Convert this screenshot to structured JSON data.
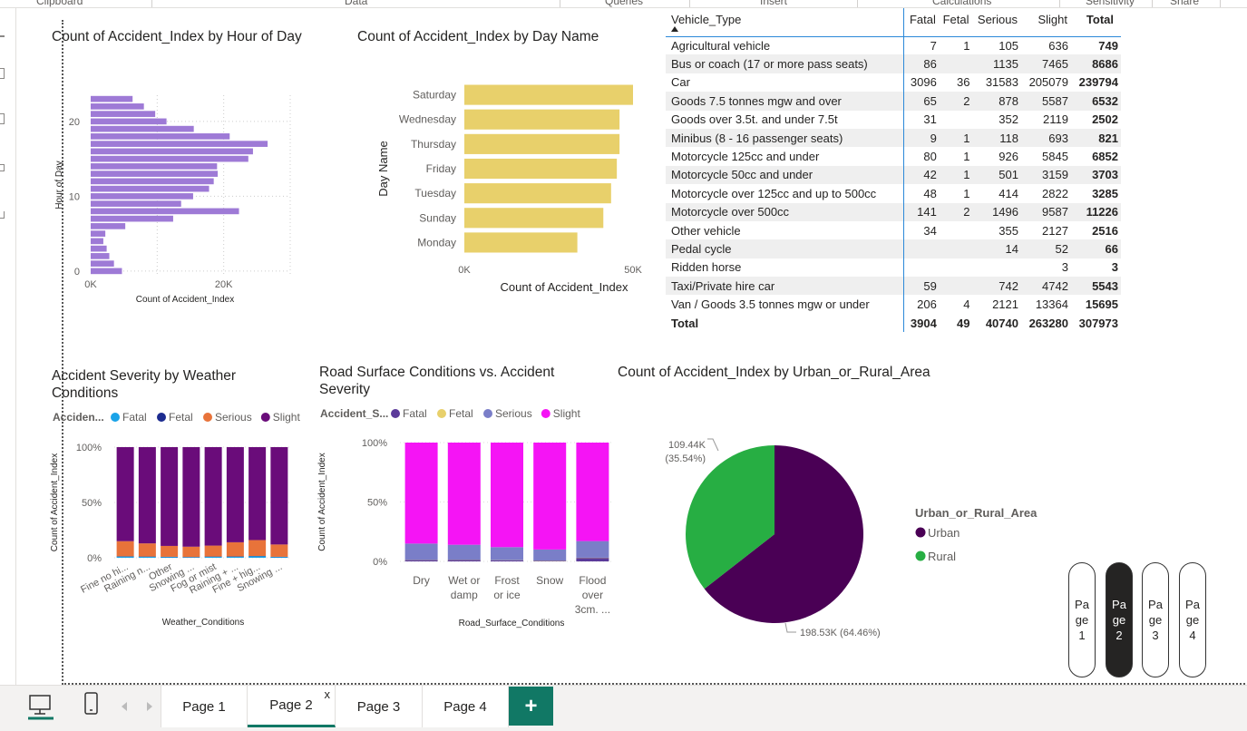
{
  "ribbon": {
    "groups": [
      "Clipboard",
      "Data",
      "Queries",
      "Insert",
      "Calculations",
      "Sensitivity",
      "Share"
    ]
  },
  "colors": {
    "hour_bar": "#9e7ad6",
    "day_bar": "#e8d06b",
    "fatal_weather": "#1aa3e8",
    "fetal_weather": "#1c2b8f",
    "serious_weather": "#e8733a",
    "slight_weather": "#6a0c7a",
    "fatal_road": "#5b3a9a",
    "fetal_road": "#e8d06b",
    "serious_road": "#7a7ec8",
    "slight_road": "#f514f5",
    "urban": "#4a0055",
    "rural": "#27ae43",
    "accent": "#117865"
  },
  "chart_data": [
    {
      "type": "bar",
      "orientation": "horizontal",
      "title": "Count of Accident_Index by Hour of Day",
      "xlabel": "Count of Accident_Index",
      "ylabel": "Hour of Day",
      "x_ticks": [
        "0K",
        "20K"
      ],
      "y_ticks": [
        "0",
        "10",
        "20"
      ],
      "xlim": [
        0,
        30000
      ],
      "categories": [
        0,
        1,
        2,
        3,
        4,
        5,
        6,
        7,
        8,
        9,
        10,
        11,
        12,
        13,
        14,
        15,
        16,
        17,
        18,
        19,
        20,
        21,
        22,
        23
      ],
      "values": [
        4700,
        3500,
        2800,
        2400,
        1900,
        2200,
        5200,
        12400,
        22300,
        13600,
        15400,
        17800,
        18500,
        19100,
        19000,
        23700,
        24400,
        26600,
        20900,
        15500,
        11400,
        9700,
        8000,
        6300
      ]
    },
    {
      "type": "bar",
      "orientation": "horizontal",
      "title": "Count of Accident_Index by Day Name",
      "xlabel": "Count of Accident_Index",
      "ylabel": "Day Name",
      "x_ticks": [
        "0K",
        "50K"
      ],
      "xlim": [
        0,
        50000
      ],
      "categories": [
        "Saturday",
        "Wednesday",
        "Thursday",
        "Friday",
        "Tuesday",
        "Sunday",
        "Monday"
      ],
      "values": [
        50000,
        46000,
        46000,
        45200,
        43500,
        41200,
        33500
      ]
    },
    {
      "type": "table",
      "columns": [
        "Vehicle_Type",
        "Fatal",
        "Fetal",
        "Serious",
        "Slight",
        "Total"
      ],
      "rows": [
        [
          "Agricultural vehicle",
          "7",
          "1",
          "105",
          "636",
          "749"
        ],
        [
          "Bus or coach (17 or more pass seats)",
          "86",
          "",
          "1135",
          "7465",
          "8686"
        ],
        [
          "Car",
          "3096",
          "36",
          "31583",
          "205079",
          "239794"
        ],
        [
          "Goods 7.5 tonnes mgw and over",
          "65",
          "2",
          "878",
          "5587",
          "6532"
        ],
        [
          "Goods over 3.5t. and under 7.5t",
          "31",
          "",
          "352",
          "2119",
          "2502"
        ],
        [
          "Minibus (8 - 16 passenger seats)",
          "9",
          "1",
          "118",
          "693",
          "821"
        ],
        [
          "Motorcycle 125cc and under",
          "80",
          "1",
          "926",
          "5845",
          "6852"
        ],
        [
          "Motorcycle 50cc and under",
          "42",
          "1",
          "501",
          "3159",
          "3703"
        ],
        [
          "Motorcycle over 125cc and up to 500cc",
          "48",
          "1",
          "414",
          "2822",
          "3285"
        ],
        [
          "Motorcycle over 500cc",
          "141",
          "2",
          "1496",
          "9587",
          "11226"
        ],
        [
          "Other vehicle",
          "34",
          "",
          "355",
          "2127",
          "2516"
        ],
        [
          "Pedal cycle",
          "",
          "",
          "14",
          "52",
          "66"
        ],
        [
          "Ridden horse",
          "",
          "",
          "",
          "3",
          "3"
        ],
        [
          "Taxi/Private hire car",
          "59",
          "",
          "742",
          "4742",
          "5543"
        ],
        [
          "Van / Goods 3.5 tonnes mgw or under",
          "206",
          "4",
          "2121",
          "13364",
          "15695"
        ]
      ],
      "total_row": [
        "Total",
        "3904",
        "49",
        "40740",
        "263280",
        "307973"
      ]
    },
    {
      "type": "bar",
      "stacked": "percent",
      "title": "Accident Severity by Weather Conditions",
      "xlabel": "Weather_Conditions",
      "ylabel": "Count of Accident_Index",
      "legend_title": "Acciden...",
      "y_ticks": [
        "0%",
        "50%",
        "100%"
      ],
      "categories": [
        "Fine no hi...",
        "Raining n...",
        "Other",
        "Snowing ...",
        "Fog or mist",
        "Raining + ...",
        "Fine + hig...",
        "Snowing ..."
      ],
      "series": [
        {
          "name": "Fatal",
          "values": [
            1.2,
            1.0,
            0.8,
            0.6,
            1.0,
            1.1,
            1.5,
            0.8
          ]
        },
        {
          "name": "Fetal",
          "values": [
            0.1,
            0.1,
            0.1,
            0.1,
            0.1,
            0.1,
            0.1,
            0.1
          ]
        },
        {
          "name": "Serious",
          "values": [
            13.7,
            11.9,
            9.8,
            9.3,
            9.9,
            12.8,
            14.4,
            11.1
          ]
        },
        {
          "name": "Slight",
          "values": [
            85.0,
            87.0,
            89.3,
            90.0,
            89.0,
            86.0,
            84.0,
            88.0
          ]
        }
      ]
    },
    {
      "type": "bar",
      "stacked": "percent",
      "title": "Road Surface Conditions vs. Accident Severity",
      "xlabel": "Road_Surface_Conditions",
      "ylabel": "Count of Accident_Index",
      "legend_title": "Accident_S...",
      "y_ticks": [
        "0%",
        "50%",
        "100%"
      ],
      "categories": [
        [
          "Dry"
        ],
        [
          "Wet or",
          "damp"
        ],
        [
          "Frost",
          "or ice"
        ],
        [
          "Snow"
        ],
        [
          "Flood",
          "over",
          "3cm. ..."
        ]
      ],
      "series": [
        {
          "name": "Fatal",
          "values": [
            1.2,
            1.3,
            0.9,
            0.6,
            3.0
          ]
        },
        {
          "name": "Fetal",
          "values": [
            0.1,
            0.1,
            0.1,
            0.1,
            0.1
          ]
        },
        {
          "name": "Serious",
          "values": [
            13.7,
            12.6,
            11.0,
            9.3,
            14.0
          ]
        },
        {
          "name": "Slight",
          "values": [
            85.0,
            86.0,
            88.0,
            90.0,
            82.9
          ]
        }
      ]
    },
    {
      "type": "pie",
      "title": "Count of Accident_Index by Urban_or_Rural_Area",
      "legend_title": "Urban_or_Rural_Area",
      "labels": [
        "Urban",
        "Rural"
      ],
      "values": [
        198530,
        109440
      ],
      "data_labels": [
        "198.53K (64.46%)",
        [
          "109.44K",
          "(35.54%)"
        ]
      ]
    }
  ],
  "navigation": {
    "buttons": [
      [
        "Pa",
        "ge",
        "1"
      ],
      [
        "Pa",
        "ge",
        "2"
      ],
      [
        "Pa",
        "ge",
        "3"
      ],
      [
        "Pa",
        "ge",
        "4"
      ]
    ],
    "active_index": 1
  },
  "tabs": {
    "items": [
      "Page 1",
      "Page 2",
      "Page 3",
      "Page 4"
    ],
    "active_index": 1,
    "close_glyph": "x",
    "add_glyph": "+"
  }
}
